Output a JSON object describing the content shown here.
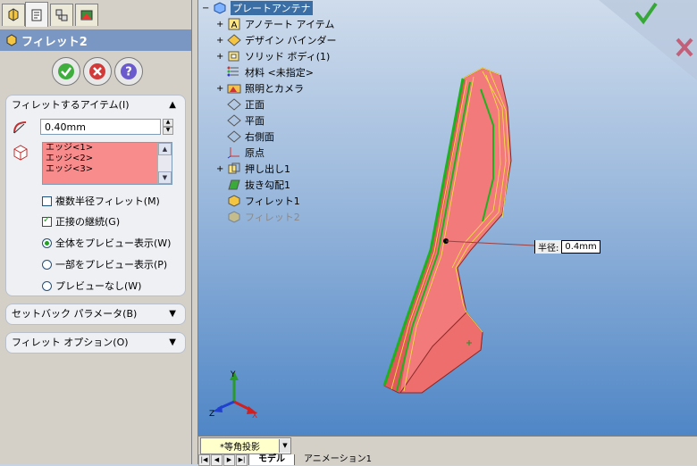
{
  "left_panel": {
    "title": "フィレット2",
    "items_group": {
      "header": "フィレットするアイテム(I)",
      "radius_value": "0.40mm",
      "edges": [
        "エッジ<1>",
        "エッジ<2>",
        "エッジ<3>"
      ],
      "multi_radius_label": "複数半径フィレット(M)",
      "multi_radius_checked": false,
      "tangent_label": "正接の継続(G)",
      "tangent_checked": true,
      "preview_options": [
        {
          "label": "全体をプレビュー表示(W)",
          "selected": true
        },
        {
          "label": "一部をプレビュー表示(P)",
          "selected": false
        },
        {
          "label": "プレビューなし(W)",
          "selected": false
        }
      ]
    },
    "setback_header": "セットバック パラメータ(B)",
    "options_header": "フィレット オプション(O)"
  },
  "tree": {
    "root": "プレートアンテナ",
    "nodes": [
      {
        "label": "アノテート アイテム",
        "expandable": true,
        "icon": "annotation-icon"
      },
      {
        "label": "デザイン バインダー",
        "expandable": true,
        "icon": "design-binder-icon"
      },
      {
        "label": "ソリッド ボディ(1)",
        "expandable": true,
        "icon": "solid-body-icon"
      },
      {
        "label": "材料 <未指定>",
        "expandable": false,
        "icon": "material-icon"
      },
      {
        "label": "照明とカメラ",
        "expandable": true,
        "icon": "lights-camera-icon"
      },
      {
        "label": "正面",
        "expandable": false,
        "icon": "plane-icon"
      },
      {
        "label": "平面",
        "expandable": false,
        "icon": "plane-icon"
      },
      {
        "label": "右側面",
        "expandable": false,
        "icon": "plane-icon"
      },
      {
        "label": "原点",
        "expandable": false,
        "icon": "origin-icon"
      },
      {
        "label": "押し出し1",
        "expandable": true,
        "icon": "extrude-icon"
      },
      {
        "label": "抜き勾配1",
        "expandable": false,
        "icon": "draft-icon"
      },
      {
        "label": "フィレット1",
        "expandable": false,
        "icon": "fillet-icon"
      },
      {
        "label": "フィレット2",
        "expandable": false,
        "icon": "fillet-icon",
        "dimmed": true
      }
    ]
  },
  "dimension": {
    "key": "半径:",
    "value": "0.4mm"
  },
  "view_combo": "*等角投影",
  "bottom_tabs": [
    "モデル",
    "アニメーション1"
  ],
  "colors": {
    "accent": "#7a96c2",
    "edge_highlight": "#f88c8c",
    "ok_green": "#2f9e2f",
    "cancel_red": "#c02020"
  }
}
